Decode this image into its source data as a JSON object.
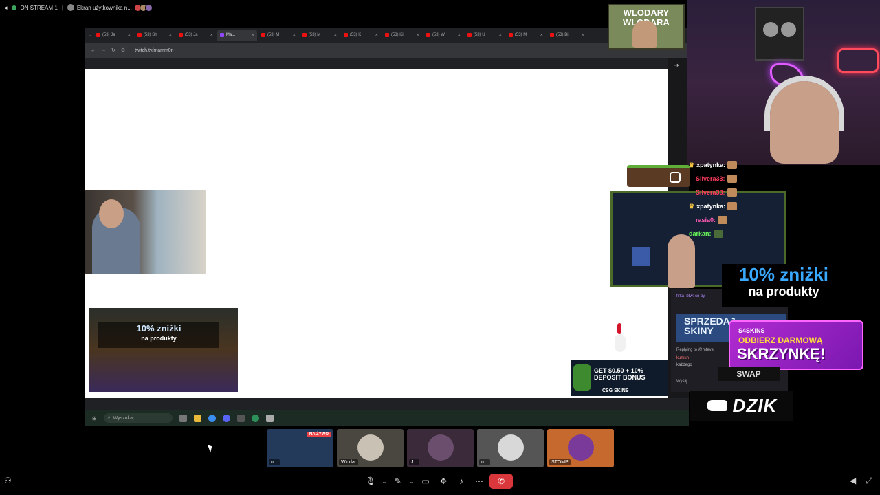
{
  "topbar": {
    "stream_label": "ON STREAM 1",
    "screen_label": "Ekran użytkownika n..."
  },
  "browser": {
    "tabs": [
      {
        "label": "(53) Ja"
      },
      {
        "label": "(53) Sh"
      },
      {
        "label": "(53) Ja"
      },
      {
        "label": "Ma..."
      },
      {
        "label": "(53) M"
      },
      {
        "label": "(53) M"
      },
      {
        "label": "(53) K"
      },
      {
        "label": "(53) Kil"
      },
      {
        "label": "(53) W"
      },
      {
        "label": "(53) U"
      },
      {
        "label": "(53) M"
      },
      {
        "label": "(53) Bi"
      }
    ],
    "url": "twitch.tv/mamm0n",
    "taskbar_search_placeholder": "Wyszukaj"
  },
  "overlays": {
    "promo_left_big": "10% zniżki",
    "promo_left_small": "na produkty",
    "csgo_ad_line1": "GET $0.50 + 10%",
    "csgo_ad_line2": "DEPOSIT BONUS",
    "csgo_ad_brand": "CSG SKINS",
    "wlodary_logo": "WLODARY WLODARA",
    "discount_big": "10% zniżki",
    "discount_small": "na produkty",
    "sprzedaj_line1": "SPRZEDAJ",
    "sprzedaj_line2": "SKINY",
    "skins_brand": "S4SKINS",
    "skins_line1": "ODBIERZ DARMOWĄ",
    "skins_line2": "SKRZYNKĘ!",
    "swap": "SWAP",
    "dzik": "DZIK"
  },
  "chat": {
    "messages": [
      {
        "user": "xpatynka:",
        "color": "#ffffff"
      },
      {
        "user": "Silvera33:",
        "color": "#ff3b5c"
      },
      {
        "user": "Silvera33:",
        "color": "#ff3b5c"
      },
      {
        "user": "xpatynka:",
        "color": "#ffffff"
      },
      {
        "user": "rasia0:",
        "color": "#ff5ab4"
      },
      {
        "user": "darkan:",
        "color": "#6cff5a"
      }
    ],
    "lower_lines": [
      "fifka_btw: co by",
      "Replying to @mtevs",
      "kurkun",
      "każdego",
      "Wyślij"
    ]
  },
  "participants": [
    {
      "name": "n...",
      "live": "NA ŻYWO",
      "color": "#233a5a"
    },
    {
      "name": "Wlodar",
      "live": "",
      "color": "#c9c1b4"
    },
    {
      "name": "J...",
      "live": "",
      "color": "#6b4e6e"
    },
    {
      "name": "n...",
      "live": "",
      "color": "#d8d8d8"
    },
    {
      "name": "STOMP",
      "live": "",
      "color": "#c6692f"
    }
  ],
  "controls": {
    "icons": [
      "mic-icon",
      "deafen-icon",
      "screen-share-icon",
      "activities-icon",
      "soundboard-icon",
      "more-icon",
      "end-call-icon"
    ]
  }
}
